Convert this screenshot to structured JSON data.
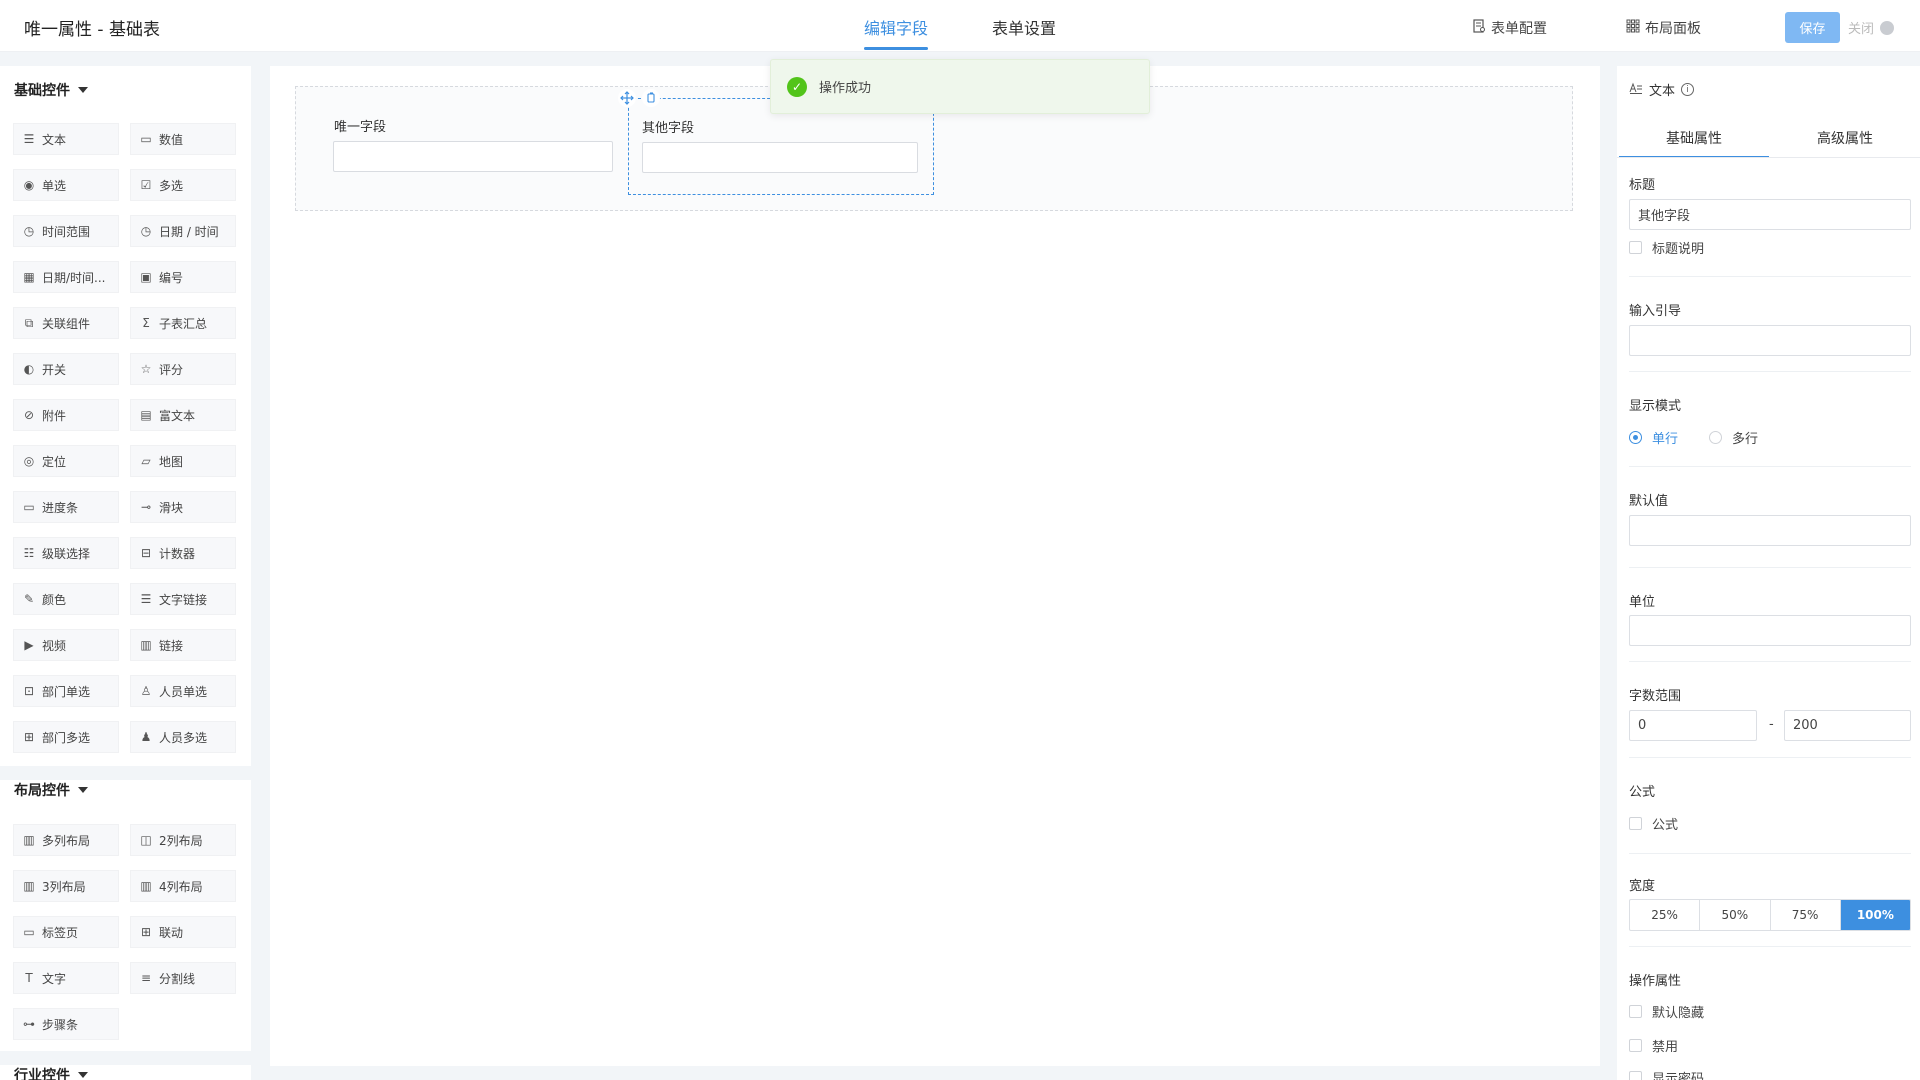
{
  "header": {
    "title": "唯一属性 - 基础表",
    "tabs": [
      {
        "label": "编辑字段",
        "active": true
      },
      {
        "label": "表单设置",
        "active": false
      }
    ],
    "form_config_label": "表单配置",
    "layout_panel_label": "布局面板",
    "save_label": "保存",
    "close_label": "关闭"
  },
  "left": {
    "basic_section": "基础控件",
    "basic_items": [
      {
        "label": "文本",
        "icon": "text-icon"
      },
      {
        "label": "数值",
        "icon": "number-icon"
      },
      {
        "label": "单选",
        "icon": "radio-icon"
      },
      {
        "label": "多选",
        "icon": "checkbox-icon"
      },
      {
        "label": "时间范围",
        "icon": "clock-icon"
      },
      {
        "label": "日期 / 时间",
        "icon": "clock-icon"
      },
      {
        "label": "日期/时间...",
        "icon": "calendar-icon"
      },
      {
        "label": "编号",
        "icon": "serial-icon"
      },
      {
        "label": "关联组件",
        "icon": "link-component-icon"
      },
      {
        "label": "子表汇总",
        "icon": "sigma-icon"
      },
      {
        "label": "开关",
        "icon": "toggle-icon"
      },
      {
        "label": "评分",
        "icon": "star-icon"
      },
      {
        "label": "附件",
        "icon": "paperclip-icon"
      },
      {
        "label": "富文本",
        "icon": "richtext-icon"
      },
      {
        "label": "定位",
        "icon": "location-icon"
      },
      {
        "label": "地图",
        "icon": "map-icon"
      },
      {
        "label": "进度条",
        "icon": "progress-icon"
      },
      {
        "label": "滑块",
        "icon": "slider-icon"
      },
      {
        "label": "级联选择",
        "icon": "cascade-icon"
      },
      {
        "label": "计数器",
        "icon": "counter-icon"
      },
      {
        "label": "颜色",
        "icon": "color-picker-icon"
      },
      {
        "label": "文字链接",
        "icon": "text-link-icon"
      },
      {
        "label": "视频",
        "icon": "video-icon"
      },
      {
        "label": "链接",
        "icon": "link-icon"
      },
      {
        "label": "部门单选",
        "icon": "department-icon"
      },
      {
        "label": "人员单选",
        "icon": "user-icon"
      },
      {
        "label": "部门多选",
        "icon": "departments-icon"
      },
      {
        "label": "人员多选",
        "icon": "users-icon"
      }
    ],
    "layout_section": "布局控件",
    "layout_items": [
      {
        "label": "多列布局",
        "icon": "columns-icon"
      },
      {
        "label": "2列布局",
        "icon": "two-columns-icon"
      },
      {
        "label": "3列布局",
        "icon": "three-columns-icon"
      },
      {
        "label": "4列布局",
        "icon": "four-columns-icon"
      },
      {
        "label": "标签页",
        "icon": "tabs-icon"
      },
      {
        "label": "联动",
        "icon": "linkage-icon"
      },
      {
        "label": "文字",
        "icon": "font-icon"
      },
      {
        "label": "分割线",
        "icon": "divider-icon"
      },
      {
        "label": "步骤条",
        "icon": "steps-icon"
      }
    ],
    "industry_section": "行业控件"
  },
  "canvas": {
    "fields": [
      {
        "label": "唯一字段",
        "value": ""
      },
      {
        "label": "其他字段",
        "value": ""
      }
    ]
  },
  "toast": {
    "message": "操作成功",
    "status_color": "#52c41a"
  },
  "right": {
    "head_label": "文本",
    "tabs": [
      {
        "label": "基础属性",
        "active": true
      },
      {
        "label": "高级属性",
        "active": false
      }
    ],
    "title_label": "标题",
    "title_value": "其他字段",
    "title_desc_label": "标题说明",
    "placeholder_label": "输入引导",
    "placeholder_value": "",
    "display_mode_label": "显示模式",
    "display_single": "单行",
    "display_multi": "多行",
    "display_selected": "单行",
    "default_label": "默认值",
    "default_value": "",
    "unit_label": "单位",
    "unit_value": "",
    "range_label": "字数范围",
    "range_min": "0",
    "range_sep": "-",
    "range_max": "200",
    "formula_section": "公式",
    "formula_checkbox": "公式",
    "width_label": "宽度",
    "width_options": [
      "25%",
      "50%",
      "75%",
      "100%"
    ],
    "width_selected": "100%",
    "ops_label": "操作属性",
    "ops": [
      "默认隐藏",
      "禁用",
      "显示密码"
    ]
  },
  "colors": {
    "accent": "#3d8fe0",
    "save_button": "#7fb8f3",
    "success": "#52c41a"
  }
}
